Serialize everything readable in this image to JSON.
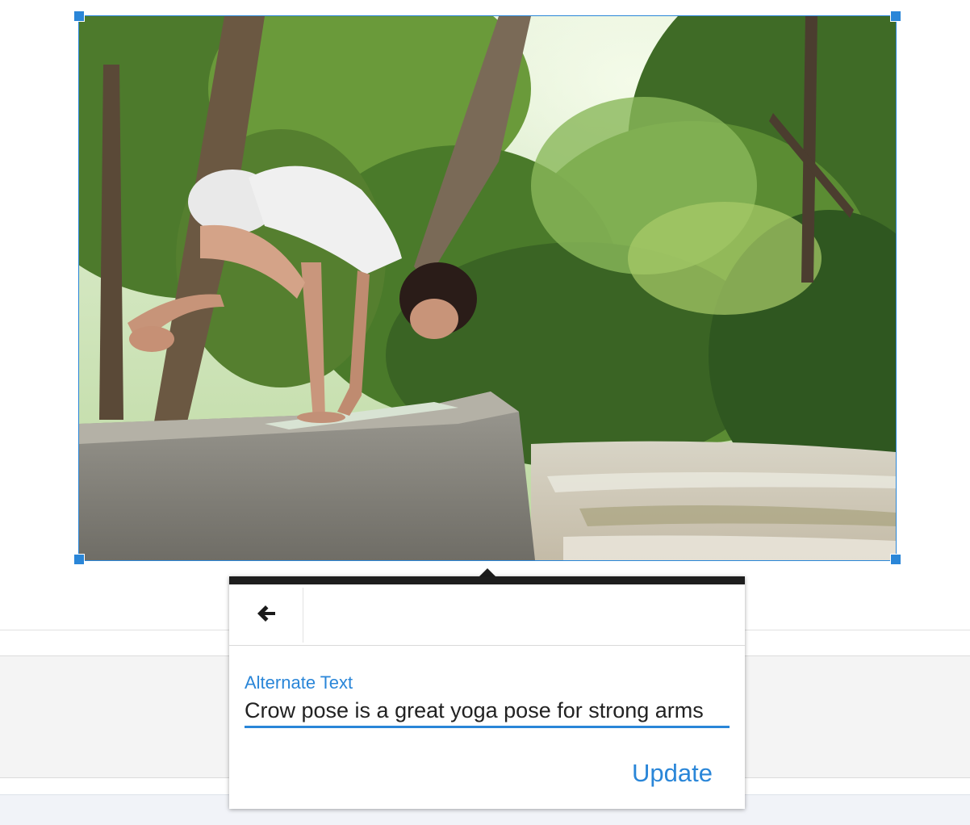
{
  "image": {
    "subject": "yoga-crow-pose-photo",
    "selected": true
  },
  "popover": {
    "back_icon": "arrow-left-icon",
    "alt_text_label": "Alternate Text",
    "alt_text_value": "Crow pose is a great yoga pose for strong arms",
    "update_label": "Update"
  },
  "colors": {
    "accent": "#2a86d8",
    "toolbar_dark": "#1e1e1e"
  }
}
